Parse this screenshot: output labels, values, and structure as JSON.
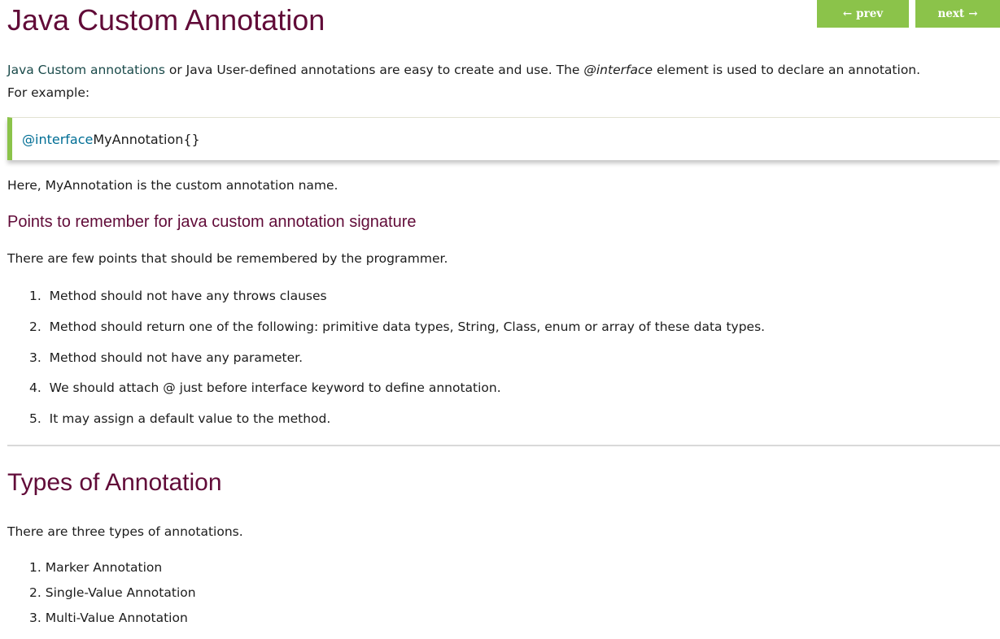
{
  "nav": {
    "prev_label": "prev",
    "next_label": "next"
  },
  "page_title": "Java Custom Annotation",
  "intro": {
    "highlight": "Java Custom annotations",
    "text1": " or Java User-defined annotations are easy to create and use. The ",
    "emph": "@interface",
    "text2": " element is used to declare an annotation.",
    "line2": "For example:"
  },
  "code": {
    "keyword": "@interface",
    "rest": " MyAnnotation{}"
  },
  "after_code": "Here, MyAnnotation is the custom annotation name.",
  "points_heading": "Points to remember for java custom annotation signature",
  "points_intro": "There are few points that should be remembered by the programmer.",
  "points": [
    {
      "num": "1.",
      "text": "Method should not have any throws clauses"
    },
    {
      "num": "2.",
      "text": "Method should return one of the following: primitive data types, String, Class, enum or array of these data types."
    },
    {
      "num": "3.",
      "text": "Method should not have any parameter."
    },
    {
      "num": "4.",
      "text": "We should attach @ just before interface keyword to define annotation."
    },
    {
      "num": "5.",
      "text": "It may assign a default value to the method."
    }
  ],
  "types_heading": "Types of Annotation",
  "types_intro": "There are three types of annotations.",
  "types": [
    {
      "num": "1.",
      "text": "Marker Annotation"
    },
    {
      "num": "2.",
      "text": "Single-Value Annotation"
    },
    {
      "num": "3.",
      "text": "Multi-Value Annotation"
    }
  ]
}
